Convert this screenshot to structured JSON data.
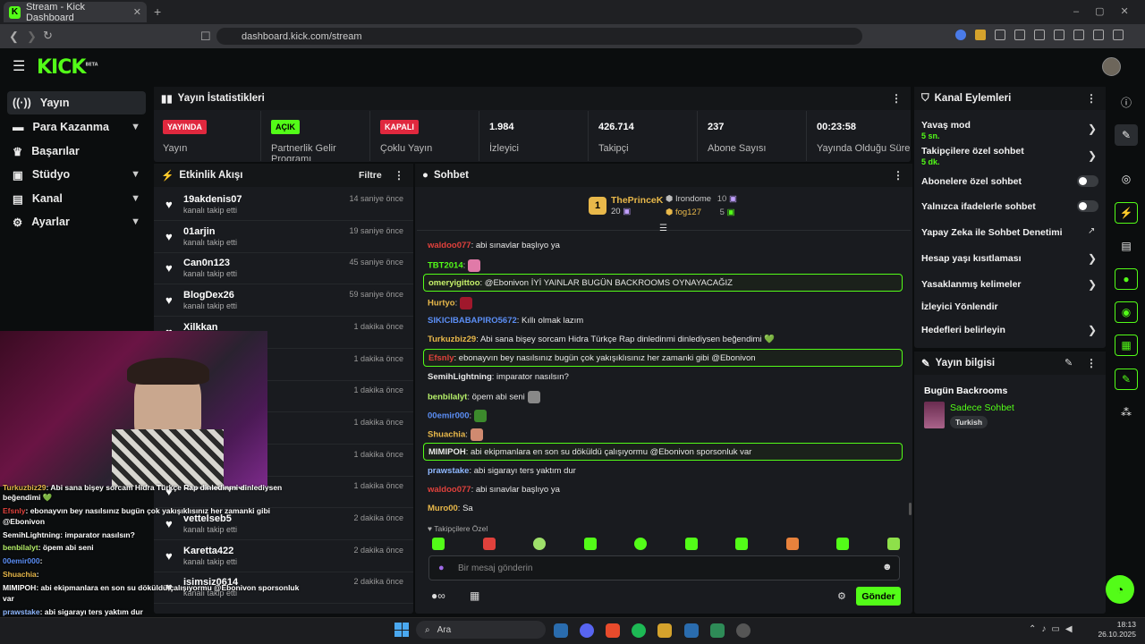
{
  "browser": {
    "tab_title": "Stream - Kick Dashboard",
    "url": "dashboard.kick.com/stream"
  },
  "logo": {
    "text": "KICK",
    "beta": "BETA"
  },
  "sidebar": {
    "items": [
      {
        "label": "Yayın"
      },
      {
        "label": "Para Kazanma"
      },
      {
        "label": "Başarılar"
      },
      {
        "label": "Stüdyo"
      },
      {
        "label": "Kanal"
      },
      {
        "label": "Ayarlar"
      }
    ]
  },
  "stats": {
    "title": "Yayın İstatistikleri",
    "cols": [
      {
        "badge": "YAYINDA",
        "label": "Yayın"
      },
      {
        "badge": "AÇIK",
        "label": "Partnerlik Gelir Programı"
      },
      {
        "badge": "KAPALI",
        "label": "Çoklu Yayın"
      },
      {
        "value": "1.984",
        "label": "İzleyici"
      },
      {
        "value": "426.714",
        "label": "Takipçi"
      },
      {
        "value": "237",
        "label": "Abone Sayısı"
      },
      {
        "value": "00:23:58",
        "label": "Yayında Olduğu Süre"
      }
    ]
  },
  "activity": {
    "title": "Etkinlik Akışı",
    "filter": "Filtre",
    "items": [
      {
        "name": "19akdenis07",
        "sub": "kanalı takip etti",
        "time": "14 saniye önce"
      },
      {
        "name": "01arjin",
        "sub": "kanalı takip etti",
        "time": "19 saniye önce"
      },
      {
        "name": "Can0n123",
        "sub": "kanalı takip etti",
        "time": "45 saniye önce"
      },
      {
        "name": "BlogDex26",
        "sub": "kanalı takip etti",
        "time": "59 saniye önce"
      },
      {
        "name": "Xilkkan",
        "sub": "",
        "time": "1 dakika önce"
      },
      {
        "name": "",
        "sub": "",
        "time": "1 dakika önce"
      },
      {
        "name": "",
        "sub": "",
        "time": "1 dakika önce"
      },
      {
        "name": "",
        "sub": "",
        "time": "1 dakika önce"
      },
      {
        "name": "",
        "sub": "",
        "time": "1 dakika önce"
      },
      {
        "name": "Erenbabapro",
        "sub": "",
        "time": "1 dakika önce"
      },
      {
        "name": "vettelseb5",
        "sub": "kanalı takip etti",
        "time": "2 dakika önce"
      },
      {
        "name": "Karetta422",
        "sub": "kanalı takip etti",
        "time": "2 dakika önce"
      },
      {
        "name": "isimsiz0614",
        "sub": "kanalı takip etti",
        "time": "2 dakika önce"
      }
    ]
  },
  "chat": {
    "title": "Sohbet",
    "leaders": {
      "first": "ThePrinceK",
      "first_count": "20",
      "second": "Irondome",
      "second_count": "10",
      "third": "fog127",
      "third_count": "5",
      "rank": "1"
    },
    "messages": [
      {
        "user": "waldoo077",
        "text": ": abi sınavlar başlıyo ya",
        "color": "#e0413c"
      },
      {
        "user": "TBT2014",
        "text": ":",
        "color": "#53fc18",
        "emote": "#e07aa8"
      },
      {
        "user": "omeryigittoo",
        "text": ": @Ebonivon İYİ YAINLAR BUGÜN BACKROOMS OYNAYACAĞIZ",
        "color": "#c6f06a",
        "box": true
      },
      {
        "user": "Hurtyo",
        "text": ":",
        "color": "#e8b84a",
        "emote": "#a0182c"
      },
      {
        "user": "SIKICIBABAPIRO5672",
        "text": ": Kıllı olmak lazım",
        "color": "#5b8ef5"
      },
      {
        "user": "Turkuzbiz29",
        "text": ": Abi sana bişey sorcam Hidra Türkçe Rap dinledinmi dinlediysen beğendimi 💚",
        "color": "#e8b84a"
      },
      {
        "user": "Efsnly",
        "text": ": ebonayvın bey nasılsınız bugün çok yakışıklısınız her zamanki gibi @Ebonivon",
        "color": "#e0413c",
        "box": true
      },
      {
        "user": "SemihLightning",
        "text": ": imparator nasılsın?",
        "color": "#e8e8e8"
      },
      {
        "user": "benbilalyt",
        "text": ":        öpem abi seni",
        "color": "#b6f06a",
        "emote": "#888"
      },
      {
        "user": "00emir000",
        "text": ":",
        "color": "#5b8ef5",
        "emote": "#3c8a2c"
      },
      {
        "user": "Shuachia",
        "text": ":",
        "color": "#e8b84a",
        "emote": "#d08a70"
      },
      {
        "user": "MIMIPOH",
        "text": ": abi ekipmanlara en son su döküldü çalışıyormu @Ebonivon sporsonluk var",
        "color": "#e8e8e8",
        "box": true
      },
      {
        "user": "prawstake",
        "text": ": abi sigarayı ters yaktım dur",
        "color": "#8fb8ff"
      },
      {
        "user": "waldoo077",
        "text": ": abi sınavlar başlıyo ya",
        "color": "#e0413c"
      },
      {
        "user": "Muro00",
        "text": ": Sa",
        "color": "#e8b84a"
      }
    ],
    "followers_only": "Takipçilere Özel",
    "placeholder": "Bir mesaj gönderin",
    "send": "Gönder"
  },
  "channel_actions": {
    "title": "Kanal Eylemleri",
    "items": [
      {
        "label": "Yavaş mod",
        "sub": "5 sn."
      },
      {
        "label": "Takipçilere özel sohbet",
        "sub": "5 dk."
      },
      {
        "label": "Abonelere özel sohbet"
      },
      {
        "label": "Yalnızca ifadelerle sohbet"
      },
      {
        "label": "Yapay Zeka ile Sohbet Denetimi"
      },
      {
        "label": "Hesap yaşı kısıtlaması"
      },
      {
        "label": "Yasaklanmış kelimeler"
      },
      {
        "label": "İzleyici Yönlendir"
      },
      {
        "label": "Hedefleri belirleyin"
      }
    ]
  },
  "stream_info": {
    "title": "Yayın bilgisi",
    "stream_title": "Bugün Backrooms",
    "category": "Sadece Sohbet",
    "tag": "Turkish"
  },
  "overlay_chat": [
    {
      "user": "Turkuzbiz29",
      "text": ": Abi sana bişey sorcam Hidra Türkçe Rap dinledinmi dinlediysen",
      "color": "#e8b84a"
    },
    {
      "user": "",
      "text": "beğendimi 💚",
      "color": "#fff"
    },
    {
      "user": "Efsnly",
      "text": ": ebonayvın bey nasılsınız bugün çok yakışıklısınız her zamanki gibi",
      "color": "#e0413c"
    },
    {
      "user": "",
      "text": "@Ebonivon",
      "color": "#fff"
    },
    {
      "user": "SemihLightning",
      "text": ": imparator nasılsın?",
      "color": "#fff"
    },
    {
      "user": "benbilalyt",
      "text": ":        öpem abi seni",
      "color": "#b6f06a"
    },
    {
      "user": "00emir000",
      "text": ":",
      "color": "#5b8ef5"
    },
    {
      "user": "Shuachia",
      "text": ":",
      "color": "#e8b84a"
    },
    {
      "user": "MIMIPOH",
      "text": ": abi ekipmanlara en son su döküldü çalışıyormu @Ebonivon sporsonluk",
      "color": "#fff"
    },
    {
      "user": "",
      "text": "var",
      "color": "#fff"
    },
    {
      "user": "prawstake",
      "text": ": abi sigarayı ters yaktım dur",
      "color": "#8fb8ff"
    },
    {
      "user": "waldoo077",
      "text": ": abi sınavlar başlıyo ya",
      "color": "#e0413c"
    }
  ],
  "taskbar": {
    "search": "Ara",
    "time": "18:13",
    "date": "26.10.2025"
  }
}
